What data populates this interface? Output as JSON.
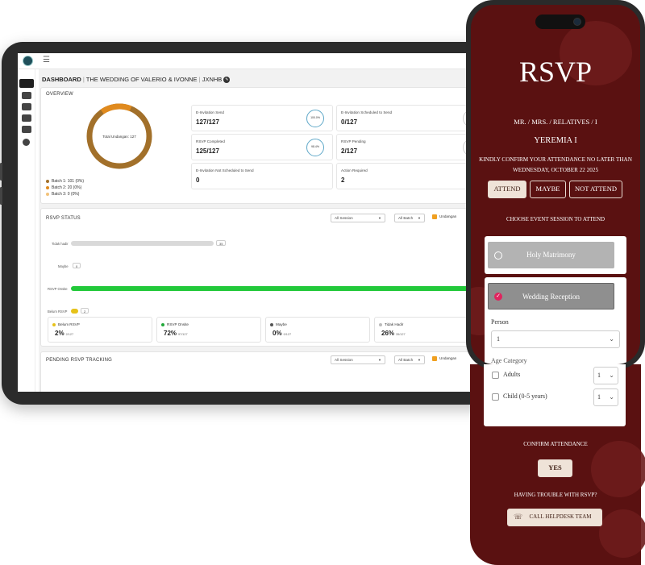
{
  "dashboard": {
    "breadcrumb": {
      "section": "DASHBOARD",
      "event": "THE WEDDING OF VALERIO & IVONNE",
      "code": "JXNHB"
    },
    "overview": {
      "title": "OVERVIEW",
      "donut_center": "Total Undangan: 127",
      "legend": [
        {
          "label": "Batch 1: 101 (0%)",
          "color": "#a2702a"
        },
        {
          "label": "Batch 2: 20 (0%)",
          "color": "#e08a1e"
        },
        {
          "label": "Batch 3: 0 (0%)",
          "color": "#f2c27a"
        }
      ],
      "stats": [
        {
          "label": "E-Invitation Send",
          "value": "127/127",
          "ring": "100.0%"
        },
        {
          "label": "E-Invitation Scheduled to Send",
          "value": "0/127",
          "ring": "0.0"
        },
        {
          "label": "RSVP Completed",
          "value": "125/127",
          "ring": "98.4%"
        },
        {
          "label": "RSVP Pending",
          "value": "2/127",
          "ring": "1.6"
        },
        {
          "label": "E-Invitation Not Scheduled to Send",
          "value": "0"
        },
        {
          "label": "Action Required",
          "value": "2"
        }
      ]
    },
    "rsvp_status": {
      "title": "RSVP STATUS",
      "session_select": "All Session",
      "batch_select": "All Batch",
      "filter_label": "Undangan",
      "bars": [
        {
          "label": "Tidak hadir",
          "count": "35",
          "fraction": 0.34,
          "color": "#d9d9d9"
        },
        {
          "label": "Maybe",
          "count": "0",
          "fraction": 0.0,
          "color": "#d9d9d9"
        },
        {
          "label": "RSVP Onsite",
          "count": "",
          "fraction": 1.0,
          "color": "#22c93a"
        },
        {
          "label": "Belum RSVP",
          "count": "2",
          "fraction": 0.02,
          "color": "#e6c21a"
        }
      ],
      "cards": [
        {
          "label": "Belum RSVP",
          "pct": "2%",
          "of": "2/127",
          "color": "#e6c21a"
        },
        {
          "label": "RSVP Onsite",
          "pct": "72%",
          "of": "97/127",
          "color": "#22a83a"
        },
        {
          "label": "Maybe",
          "pct": "0%",
          "of": "0/127",
          "color": "#555555"
        },
        {
          "label": "Tidak Hadir",
          "pct": "26%",
          "of": "35/127",
          "color": "#bbbbbb"
        }
      ]
    },
    "pending": {
      "title": "PENDING RSVP TRACKING",
      "session_select": "All Session",
      "batch_select": "All Batch",
      "filter_label": "Undangan"
    }
  },
  "rsvp_form": {
    "title": "RSVP",
    "salutation": "MR. / MRS. / RELATIVES / I",
    "guest_name": "YEREMIA I",
    "confirm_line1": "KINDLY CONFIRM YOUR ATTENDANCE NO LATER THAN",
    "confirm_line2": "WEDNESDAY, OCTOBER 22 2025",
    "attend_options": [
      "ATTEND",
      "MAYBE",
      "NOT ATTEND"
    ],
    "selected_attend": "ATTEND",
    "session_prompt": "CHOOSE EVENT SESSION TO ATTEND",
    "sessions": [
      {
        "label": "Holy Matrimony",
        "selected": false
      },
      {
        "label": "Wedding Reception",
        "selected": true
      }
    ],
    "person_label": "Person",
    "person_value": "1",
    "age_category_label": "Age Category",
    "age_options": [
      {
        "label": "Adults",
        "value": "1"
      },
      {
        "label": "Child (0-5 years)",
        "value": "1"
      }
    ],
    "confirm_attendance_label": "CONFIRM ATTENDANCE",
    "yes_button": "YES",
    "trouble_label": "HAVING TROUBLE WITH RSVP?",
    "helpdesk_button": "CALL HELPDESK TEAM"
  },
  "colors": {
    "maroon": "#5a1111",
    "cream": "#efe3d8",
    "accent_pink": "#e0245e",
    "onsite_green": "#22c93a"
  }
}
